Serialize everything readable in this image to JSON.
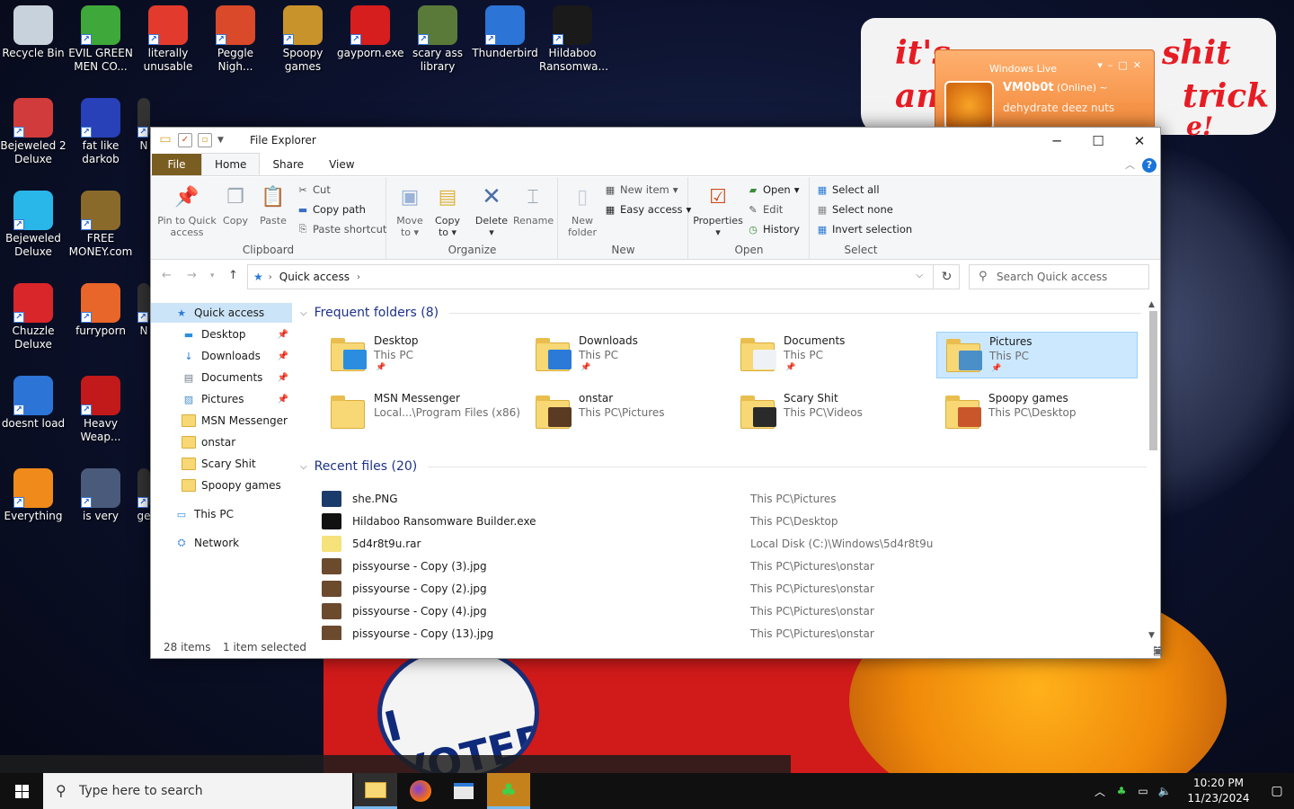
{
  "desktop": {
    "icons": [
      {
        "label": "Recycle Bin",
        "color": "#c8d2dc"
      },
      {
        "label": "EVIL GREEN MEN CO...",
        "color": "#3fa83a"
      },
      {
        "label": "literally unusable",
        "color": "#e23b2d"
      },
      {
        "label": "Peggle Nigh...",
        "color": "#d9492a"
      },
      {
        "label": "Spoopy games",
        "color": "#c9932b"
      },
      {
        "label": "gayporn.exe",
        "color": "#d61e1e"
      },
      {
        "label": "scary ass library",
        "color": "#5a7a3a"
      },
      {
        "label": "Thunderbird",
        "color": "#2c74d6"
      },
      {
        "label": "Hildaboo Ransomwa...",
        "color": "#1a1a1a"
      },
      {
        "label": "Bejeweled 2 Deluxe",
        "color": "#d23b3b"
      },
      {
        "label": "fat like darkob",
        "color": "#2840b8"
      },
      {
        "label": "Bejeweled Deluxe",
        "color": "#29b6e8"
      },
      {
        "label": "FREE MONEY.com",
        "color": "#8a6a2a"
      },
      {
        "label": "Chuzzle Deluxe",
        "color": "#d8262a"
      },
      {
        "label": "furryporn",
        "color": "#e8662a"
      },
      {
        "label": "doesnt load",
        "color": "#2c74d6"
      },
      {
        "label": "Heavy Weap...",
        "color": "#c21a1a"
      },
      {
        "label": "Everything",
        "color": "#f08a1a"
      },
      {
        "label": "is very",
        "color": "#4a5a7a"
      },
      {
        "label": "N",
        "color": "#333"
      },
      {
        "label": "N",
        "color": "#333"
      },
      {
        "label": "ge",
        "color": "#333"
      }
    ],
    "whiteboard_text": [
      "it's",
      "shit",
      "an",
      "trick",
      "e!"
    ],
    "sticker_text": "I VOTED"
  },
  "messenger": {
    "title": "Windows Live",
    "name": "VM0b0t",
    "status": "(Online) ~",
    "message": "dehydrate deez nuts"
  },
  "explorer": {
    "window_title": "File Explorer",
    "tabs": [
      "File",
      "Home",
      "Share",
      "View"
    ],
    "ribbon": {
      "clipboard": {
        "label": "Clipboard",
        "pin": "Pin to Quick access",
        "copy": "Copy",
        "paste": "Paste",
        "cut": "Cut",
        "copy_path": "Copy path",
        "paste_shortcut": "Paste shortcut"
      },
      "organize": {
        "label": "Organize",
        "move_to": "Move to",
        "copy_to": "Copy to",
        "delete": "Delete",
        "rename": "Rename"
      },
      "new": {
        "label": "New",
        "new_folder": "New folder",
        "new_item": "New item",
        "easy_access": "Easy access"
      },
      "open": {
        "label": "Open",
        "properties": "Properties",
        "open": "Open",
        "edit": "Edit",
        "history": "History"
      },
      "select": {
        "label": "Select",
        "select_all": "Select all",
        "select_none": "Select none",
        "invert": "Invert selection"
      }
    },
    "address": {
      "crumb": "Quick access",
      "search_placeholder": "Search Quick access"
    },
    "nav": [
      {
        "label": "Quick access",
        "icon": "star-icon",
        "pinned": false,
        "level": 1
      },
      {
        "label": "Desktop",
        "icon": "desktop-icon",
        "pinned": true,
        "level": 2
      },
      {
        "label": "Downloads",
        "icon": "download-icon",
        "pinned": true,
        "level": 2
      },
      {
        "label": "Documents",
        "icon": "document-icon",
        "pinned": true,
        "level": 2
      },
      {
        "label": "Pictures",
        "icon": "pictures-icon",
        "pinned": true,
        "level": 2
      },
      {
        "label": "MSN Messenger",
        "icon": "folder-icon",
        "pinned": false,
        "level": 2
      },
      {
        "label": "onstar",
        "icon": "folder-icon",
        "pinned": false,
        "level": 2
      },
      {
        "label": "Scary Shit",
        "icon": "folder-icon",
        "pinned": false,
        "level": 2
      },
      {
        "label": "Spoopy games",
        "icon": "folder-icon",
        "pinned": false,
        "level": 2
      },
      {
        "label": "This PC",
        "icon": "computer-icon",
        "pinned": false,
        "level": 1
      },
      {
        "label": "Network",
        "icon": "network-icon",
        "pinned": false,
        "level": 1
      }
    ],
    "frequent_header": "Frequent folders (8)",
    "frequent": [
      {
        "name": "Desktop",
        "path": "This PC",
        "pinned": true,
        "overlay": "#2b8de0"
      },
      {
        "name": "Downloads",
        "path": "This PC",
        "pinned": true,
        "overlay": "#2b7ad8"
      },
      {
        "name": "Documents",
        "path": "This PC",
        "pinned": true,
        "overlay": "#eef2f6"
      },
      {
        "name": "Pictures",
        "path": "This PC",
        "pinned": true,
        "overlay": "#4a8fc8",
        "selected": true
      },
      {
        "name": "MSN Messenger",
        "path": "Local...\\Program Files (x86)",
        "pinned": false,
        "overlay": ""
      },
      {
        "name": "onstar",
        "path": "This PC\\Pictures",
        "pinned": false,
        "overlay": "#5a3a22"
      },
      {
        "name": "Scary Shit",
        "path": "This PC\\Videos",
        "pinned": false,
        "overlay": "#2a2a2a"
      },
      {
        "name": "Spoopy games",
        "path": "This PC\\Desktop",
        "pinned": false,
        "overlay": "#c9562b"
      }
    ],
    "recent_header": "Recent files (20)",
    "recent": [
      {
        "name": "she.PNG",
        "path": "This PC\\Pictures",
        "color": "#1b3b6b"
      },
      {
        "name": "Hildaboo Ransomware Builder.exe",
        "path": "This PC\\Desktop",
        "color": "#111"
      },
      {
        "name": "5d4r8t9u.rar",
        "path": "Local Disk (C:)\\Windows\\5d4r8t9u",
        "color": "#f5e27a"
      },
      {
        "name": "pissyourse - Copy (3).jpg",
        "path": "This PC\\Pictures\\onstar",
        "color": "#6b4a2e"
      },
      {
        "name": "pissyourse - Copy (2).jpg",
        "path": "This PC\\Pictures\\onstar",
        "color": "#6b4a2e"
      },
      {
        "name": "pissyourse - Copy (4).jpg",
        "path": "This PC\\Pictures\\onstar",
        "color": "#6b4a2e"
      },
      {
        "name": "pissyourse - Copy (13).jpg",
        "path": "This PC\\Pictures\\onstar",
        "color": "#6b4a2e"
      }
    ],
    "status": {
      "items": "28 items",
      "selected": "1 item selected"
    }
  },
  "taskbar": {
    "search_placeholder": "Type here to search",
    "time": "10:20 PM",
    "date": "11/23/2024"
  }
}
